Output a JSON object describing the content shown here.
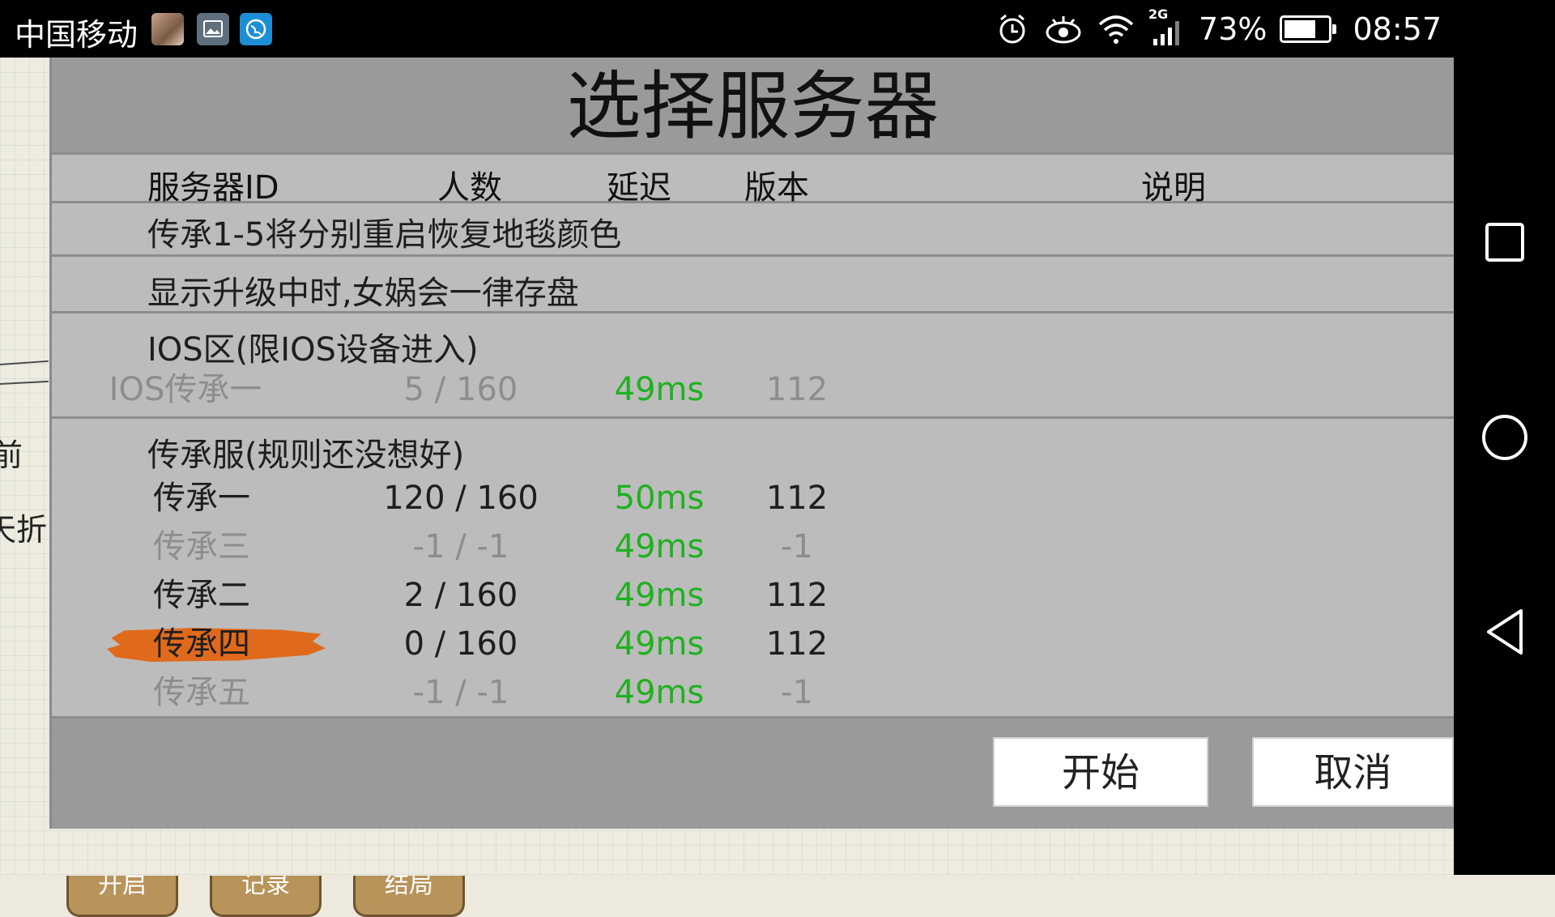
{
  "status_bar": {
    "carrier": "中国移动",
    "network_badge": "2G",
    "battery_percent": "73%",
    "battery_level": 0.73,
    "time": "08:57",
    "icons": [
      "photo-avatar-icon",
      "gallery-icon",
      "browser-icon",
      "alarm-icon",
      "eye-icon",
      "wifi-icon",
      "signal-icon",
      "battery-icon"
    ]
  },
  "background": {
    "side_texts": [
      "前",
      "天折"
    ],
    "bottom_buttons": [
      "开启",
      "记录",
      "结局"
    ]
  },
  "dialog": {
    "title": "选择服务器",
    "columns": [
      "服务器ID",
      "人数",
      "延迟",
      "版本",
      "说明"
    ],
    "notices": [
      "传承1-5将分别重启恢复地毯颜色",
      "显示升级中时,女娲会一律存盘"
    ],
    "groups": [
      {
        "title": "IOS区(限IOS设备进入)",
        "servers": [
          {
            "id": "IOS传承一",
            "population": "5 / 160",
            "latency": "49ms",
            "version": "112",
            "state": "dim"
          }
        ]
      },
      {
        "title": "传承服(规则还没想好)",
        "servers": [
          {
            "id": "传承一",
            "population": "120 / 160",
            "latency": "50ms",
            "version": "112",
            "state": "normal"
          },
          {
            "id": "传承三",
            "population": "-1 / -1",
            "latency": "49ms",
            "version": "-1",
            "state": "dim"
          },
          {
            "id": "传承二",
            "population": "2 / 160",
            "latency": "49ms",
            "version": "112",
            "state": "normal"
          },
          {
            "id": "传承四",
            "population": "0 / 160",
            "latency": "49ms",
            "version": "112",
            "state": "selected"
          },
          {
            "id": "传承五",
            "population": "-1 / -1",
            "latency": "49ms",
            "version": "-1",
            "state": "dim"
          }
        ]
      }
    ],
    "buttons": {
      "start": "开始",
      "cancel": "取消"
    },
    "colors": {
      "latency": "#1fb11f",
      "selection_brush": "#e06a1c",
      "title_bar": "#9a9a9a",
      "list_bg": "#bcbcbc"
    }
  }
}
